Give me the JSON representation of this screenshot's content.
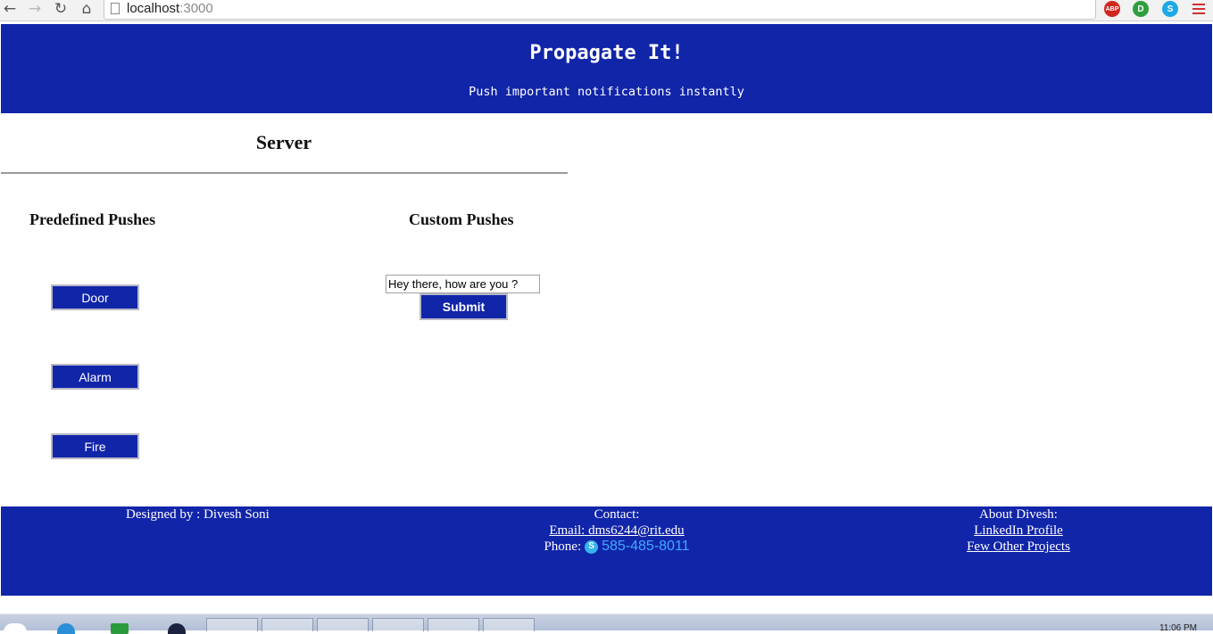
{
  "browser": {
    "url_host": "localhost",
    "url_port": ":3000",
    "extensions": [
      "ABP",
      "D",
      "S"
    ]
  },
  "header": {
    "title": "Propagate It!",
    "subtitle": "Push important notifications instantly"
  },
  "server": {
    "title": "Server",
    "predefined": {
      "heading": "Predefined Pushes",
      "buttons": [
        "Door",
        "Alarm",
        "Fire"
      ]
    },
    "custom": {
      "heading": "Custom Pushes",
      "input_value": "Hey there, how are you ?",
      "submit_label": "Submit"
    }
  },
  "footer": {
    "designed_by": "Designed by : Divesh Soni",
    "contact_heading": "Contact:",
    "email_link": "Email: dms6244@rit.edu",
    "phone_label": "Phone:",
    "phone_number": "585-485-8011",
    "about_heading": "About Divesh:",
    "linkedin_link": "LinkedIn Profile",
    "projects_link": "Few Other Projects"
  },
  "taskbar": {
    "clock": "11:06 PM"
  },
  "colors": {
    "brand_blue": "#1125a9",
    "phone_blue": "#41a9ff"
  }
}
